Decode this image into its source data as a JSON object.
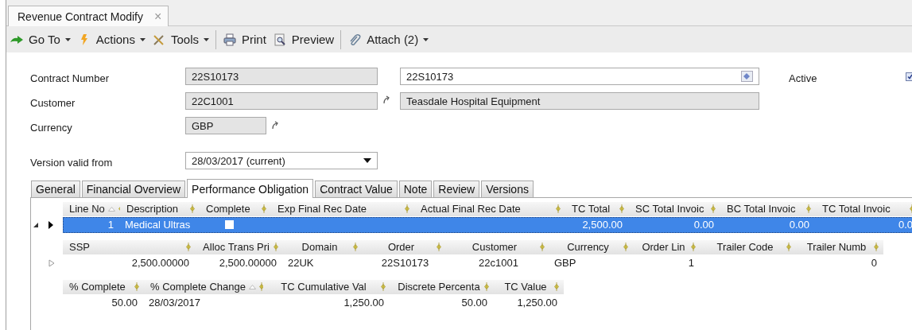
{
  "document_tab": {
    "title": "Revenue Contract Modify",
    "close": "×"
  },
  "toolbar": [
    [
      {
        "label": "Go To",
        "dropdown": true
      },
      {
        "label": "Actions",
        "dropdown": true
      },
      {
        "label": "Tools",
        "dropdown": true
      }
    ],
    [
      {
        "label": "Print",
        "dropdown": false
      },
      {
        "label": "Preview",
        "dropdown": false
      }
    ],
    [
      {
        "label": "Attach (2)",
        "dropdown": true
      }
    ]
  ],
  "form": {
    "contract_number": {
      "label": "Contract Number",
      "code": "22S10173",
      "value": "22S10173"
    },
    "customer": {
      "label": "Customer",
      "code": "22C1001",
      "name": "Teasdale Hospital Equipment"
    },
    "currency": {
      "label": "Currency",
      "code": "GBP"
    },
    "version": {
      "label": "Version valid from",
      "value": "28/03/2017 (current)"
    },
    "active": {
      "label": "Active",
      "checked": true
    }
  },
  "tabs": [
    {
      "label": "General",
      "selected": false
    },
    {
      "label": "Financial Overview",
      "selected": false
    },
    {
      "label": "Performance Obligation",
      "selected": true
    },
    {
      "label": "Contract Value",
      "selected": false
    },
    {
      "label": "Note",
      "selected": false
    },
    {
      "label": "Review",
      "selected": false
    },
    {
      "label": "Versions",
      "selected": false
    }
  ],
  "grid": {
    "bands": [
      {
        "columns": [
          {
            "label": "Line No",
            "sorted": true,
            "kind": "text"
          },
          {
            "label": "Description",
            "sorted": false,
            "kind": "text"
          },
          {
            "label": "Complete",
            "sorted": false,
            "kind": "check"
          },
          {
            "label": "Exp Final Rec Date",
            "sorted": false,
            "kind": "text"
          },
          {
            "label": "Actual Final Rec Date",
            "sorted": false,
            "kind": "text"
          },
          {
            "label": "TC Total",
            "sorted": false,
            "kind": "text"
          },
          {
            "label": "SC Total Invoic",
            "sorted": false,
            "kind": "text"
          },
          {
            "label": "BC Total Invoic",
            "sorted": false,
            "kind": "text"
          },
          {
            "label": "TC Total Invoic",
            "sorted": false,
            "kind": "text"
          }
        ],
        "rows": [
          {
            "selected": true,
            "expanded": true,
            "cells": [
              "1",
              "Medical Ultras",
              false,
              null,
              null,
              "2,500.00",
              "0.00",
              "0.00",
              "0.0"
            ]
          }
        ]
      },
      {
        "columns": [
          {
            "label": "SSP",
            "sorted": false,
            "kind": "text"
          },
          {
            "label": "Alloc Trans Pri",
            "sorted": false,
            "kind": "text"
          },
          {
            "label": "Domain",
            "sorted": false,
            "kind": "text"
          },
          {
            "label": "Order",
            "sorted": false,
            "kind": "text"
          },
          {
            "label": "Customer",
            "sorted": false,
            "kind": "text"
          },
          {
            "label": "Currency",
            "sorted": false,
            "kind": "text"
          },
          {
            "label": "Order Lin",
            "sorted": false,
            "kind": "text"
          },
          {
            "label": "Trailer Code",
            "sorted": false,
            "kind": "text"
          },
          {
            "label": "Trailer Numb",
            "sorted": false,
            "kind": "text"
          }
        ],
        "rows": [
          {
            "selected": false,
            "expanded": false,
            "cells": [
              "2,500.00000",
              "2,500.00000",
              "22UK",
              "22S10173",
              "22c1001",
              "GBP",
              "1",
              null,
              "0"
            ]
          }
        ]
      },
      {
        "columns": [
          {
            "label": "% Complete",
            "sorted": false,
            "kind": "text"
          },
          {
            "label": "% Complete Change",
            "sorted": true,
            "kind": "text"
          },
          {
            "label": "TC Cumulative Val",
            "sorted": false,
            "kind": "text"
          },
          {
            "label": "Discrete Percenta",
            "sorted": false,
            "kind": "text"
          },
          {
            "label": "TC Value",
            "sorted": false,
            "kind": "text"
          }
        ],
        "rows": [
          {
            "selected": false,
            "cells": [
              "50.00",
              "28/03/2017",
              "1,250.00",
              "50.00",
              "1,250.00"
            ]
          }
        ]
      }
    ]
  }
}
